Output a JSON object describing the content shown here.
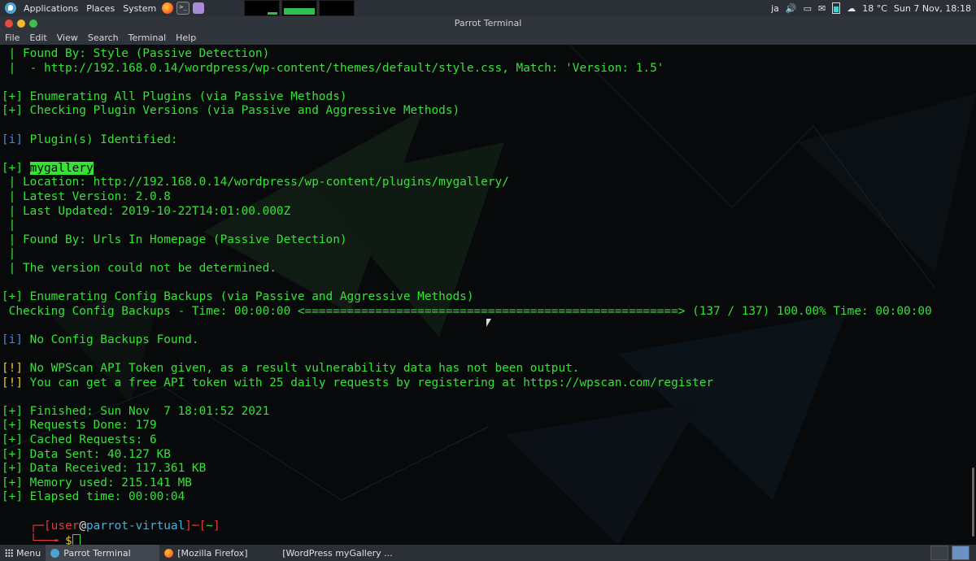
{
  "top_panel": {
    "applications": "Applications",
    "places": "Places",
    "system": "System",
    "keyboard_layout": "ja",
    "weather": "18 °C",
    "clock": "Sun 7 Nov, 18:18"
  },
  "window": {
    "title": "Parrot Terminal"
  },
  "menu": {
    "file": "File",
    "edit": "Edit",
    "view": "View",
    "search": "Search",
    "terminal": "Terminal",
    "help": "Help"
  },
  "terminal": {
    "lines": [
      {
        "prefix": " | ",
        "prefix_class": "",
        "text": "Found By: Style (Passive Detection)"
      },
      {
        "prefix": " |  ",
        "prefix_class": "",
        "text": "- http://192.168.0.14/wordpress/wp-content/themes/default/style.css, Match: 'Version: 1.5'"
      },
      {
        "prefix": "",
        "prefix_class": "",
        "text": ""
      },
      {
        "prefix": "[+] ",
        "prefix_class": "",
        "text": "Enumerating All Plugins (via Passive Methods)"
      },
      {
        "prefix": "[+] ",
        "prefix_class": "",
        "text": "Checking Plugin Versions (via Passive and Aggressive Methods)"
      },
      {
        "prefix": "",
        "prefix_class": "",
        "text": ""
      },
      {
        "prefix": "[i] ",
        "prefix_class": "blue",
        "text": "Plugin(s) Identified:"
      },
      {
        "prefix": "",
        "prefix_class": "",
        "text": ""
      },
      {
        "prefix": "[+] ",
        "prefix_class": "",
        "text": "mygallery",
        "highlight": true
      },
      {
        "prefix": " | ",
        "prefix_class": "",
        "text": "Location: http://192.168.0.14/wordpress/wp-content/plugins/mygallery/"
      },
      {
        "prefix": " | ",
        "prefix_class": "",
        "text": "Latest Version: 2.0.8"
      },
      {
        "prefix": " | ",
        "prefix_class": "",
        "text": "Last Updated: 2019-10-22T14:01:00.000Z"
      },
      {
        "prefix": " |",
        "prefix_class": "",
        "text": ""
      },
      {
        "prefix": " | ",
        "prefix_class": "",
        "text": "Found By: Urls In Homepage (Passive Detection)"
      },
      {
        "prefix": " |",
        "prefix_class": "",
        "text": ""
      },
      {
        "prefix": " | ",
        "prefix_class": "",
        "text": "The version could not be determined."
      },
      {
        "prefix": "",
        "prefix_class": "",
        "text": ""
      },
      {
        "prefix": "[+] ",
        "prefix_class": "",
        "text": "Enumerating Config Backups (via Passive and Aggressive Methods)"
      },
      {
        "prefix": " ",
        "prefix_class": "",
        "text": "Checking Config Backups - Time: 00:00:00 <=====================================================> (137 / 137) 100.00% Time: 00:00:00"
      },
      {
        "prefix": "",
        "prefix_class": "",
        "text": ""
      },
      {
        "prefix": "[i] ",
        "prefix_class": "blue",
        "text": "No Config Backups Found."
      },
      {
        "prefix": "",
        "prefix_class": "",
        "text": ""
      },
      {
        "prefix": "[!] ",
        "prefix_class": "yel",
        "text": "No WPScan API Token given, as a result vulnerability data has not been output."
      },
      {
        "prefix": "[!] ",
        "prefix_class": "yel",
        "text": "You can get a free API token with 25 daily requests by registering at https://wpscan.com/register"
      },
      {
        "prefix": "",
        "prefix_class": "",
        "text": ""
      },
      {
        "prefix": "[+] ",
        "prefix_class": "",
        "text": "Finished: Sun Nov  7 18:01:52 2021"
      },
      {
        "prefix": "[+] ",
        "prefix_class": "",
        "text": "Requests Done: 179"
      },
      {
        "prefix": "[+] ",
        "prefix_class": "",
        "text": "Cached Requests: 6"
      },
      {
        "prefix": "[+] ",
        "prefix_class": "",
        "text": "Data Sent: 40.127 KB"
      },
      {
        "prefix": "[+] ",
        "prefix_class": "",
        "text": "Data Received: 117.361 KB"
      },
      {
        "prefix": "[+] ",
        "prefix_class": "",
        "text": "Memory used: 215.141 MB"
      },
      {
        "prefix": "[+] ",
        "prefix_class": "",
        "text": "Elapsed time: 00:00:04"
      }
    ],
    "prompt": {
      "user": "user",
      "host": "parrot-virtual",
      "dir": "~",
      "symbol": "$"
    }
  },
  "taskbar": {
    "menu": "Menu",
    "items": [
      "Parrot Terminal",
      "[Mozilla Firefox]",
      "[WordPress myGallery ..."
    ]
  },
  "colors": {
    "terminal_green": "#34e334",
    "info_blue": "#4a86d8",
    "warn_yellow": "#e7c63a",
    "prompt_red": "#e23a3a"
  }
}
